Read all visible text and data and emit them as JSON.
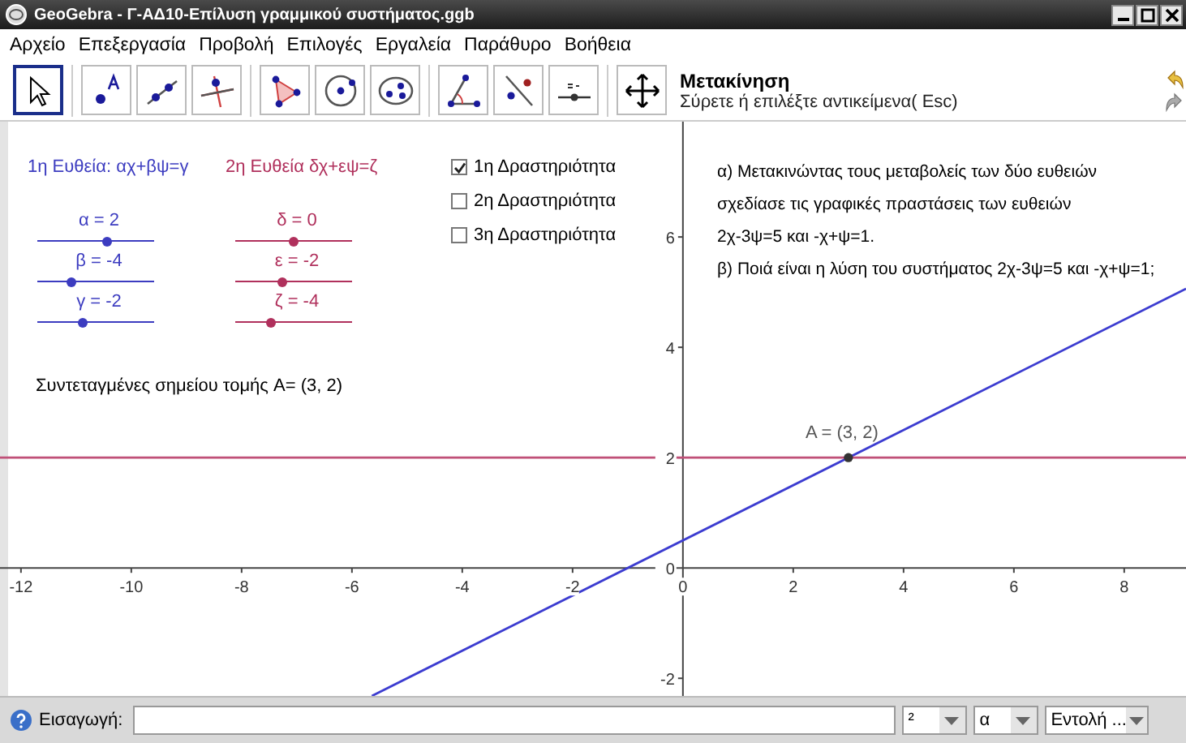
{
  "window": {
    "title": "GeoGebra - Γ-ΑΔ10-Επίλυση γραμμικού συστήματος.ggb"
  },
  "menu": [
    "Αρχείο",
    "Επεξεργασία",
    "Προβολή",
    "Επιλογές",
    "Εργαλεία",
    "Παράθυρο",
    "Βοήθεια"
  ],
  "toolbar": {
    "tools": [
      {
        "kind": "move",
        "selected": true
      },
      {
        "kind": "point",
        "selected": false
      },
      {
        "kind": "line",
        "selected": false
      },
      {
        "kind": "perpendicular",
        "selected": false
      },
      {
        "kind": "polygon",
        "selected": false
      },
      {
        "kind": "circle",
        "selected": false
      },
      {
        "kind": "conic",
        "selected": false
      },
      {
        "kind": "angle",
        "selected": false
      },
      {
        "kind": "reflect",
        "selected": false
      },
      {
        "kind": "slider",
        "selected": false
      },
      {
        "kind": "pan",
        "selected": false
      }
    ],
    "tool_name": "Μετακίνηση",
    "tool_help": "Σύρετε ή επιλέξτε αντικείμενα( Esc)"
  },
  "graphics": {
    "slider_groups": [
      {
        "heading": "1η Ευθεία: αχ+βψ=γ",
        "color": "#3c3cc0",
        "sliders": [
          {
            "label": "α = 2",
            "level": 0.6
          },
          {
            "label": "β = -4",
            "level": 0.29
          },
          {
            "label": "γ = -2",
            "level": 0.39
          }
        ]
      },
      {
        "heading": "2η Ευθεία δχ+εψ=ζ",
        "color": "#b0305c",
        "sliders": [
          {
            "label": "δ = 0",
            "level": 0.5
          },
          {
            "label": "ε = -2",
            "level": 0.4
          },
          {
            "label": "ζ = -4",
            "level": 0.3
          }
        ]
      }
    ],
    "checkboxes": [
      {
        "label": "1η Δραστηριότητα",
        "checked": true
      },
      {
        "label": "2η Δραστηριότητα",
        "checked": false
      },
      {
        "label": "3η Δραστηριότητα",
        "checked": false
      }
    ],
    "intersection_text": "Συντεταγμένες σημείου τομής A=  (3, 2)",
    "instructions": [
      "α) Μετακινώντας τους μεταβολείς των δύο ευθειών",
      "σχεδίασε τις γραφικές πραστάσεις των ευθειών",
      "2χ-3ψ=5 και -χ+ψ=1.",
      "β) Ποιά είναι η λύση του συστήματος 2χ-3ψ=5 και -χ+ψ=1;"
    ],
    "chart_data": {
      "type": "line",
      "x": [
        -12.38,
        -5.64,
        9.12
      ],
      "series": [
        {
          "color": "#3c3cd0",
          "values": [
            null,
            -2.32,
            5.06
          ]
        },
        {
          "color": "#c05078",
          "values": [
            2,
            2,
            2
          ]
        }
      ],
      "xlim": [
        -12.38,
        9.12
      ],
      "ylim": [
        -2.32,
        8.09
      ],
      "xticks": [
        -12,
        -10,
        -8,
        -6,
        -4,
        -2,
        0,
        2,
        4,
        6,
        8
      ],
      "yticks": [
        -2,
        0,
        2,
        4,
        6
      ],
      "annotations": [
        {
          "text": "A = (3, 2)",
          "x": 3,
          "y": 2
        }
      ]
    }
  },
  "input_bar": {
    "label": "Εισαγωγή:",
    "dropdowns": [
      "²",
      "α",
      "Εντολή ..."
    ]
  }
}
